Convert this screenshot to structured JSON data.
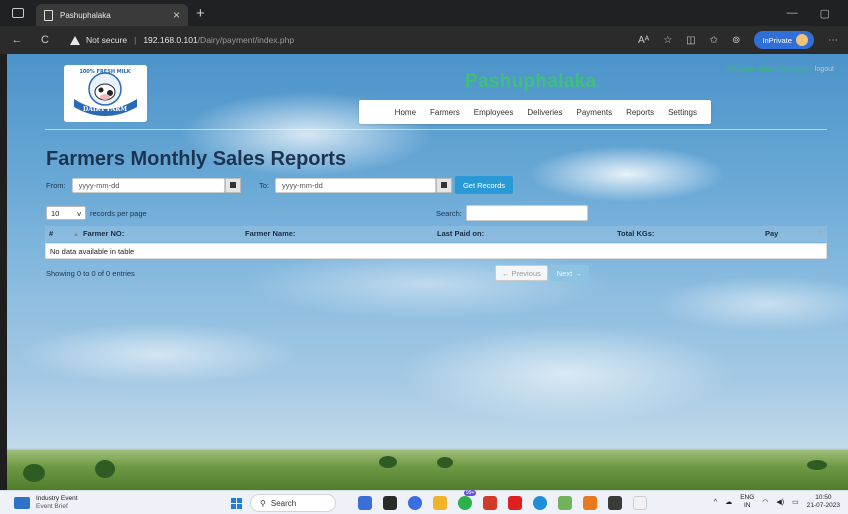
{
  "browser": {
    "tab_title": "Pashuphalaka",
    "close_tab": "×",
    "new_tab": "+",
    "back": "←",
    "reload": "C",
    "security_label": "Not secure",
    "separator": "|",
    "url_host": "192.168.0.101",
    "url_path": "/Dairy/payment/index.php",
    "read_aloud": "Aᴬ",
    "favorite": "☆",
    "split": "◫",
    "favorites_bar": "✩",
    "extensions": "⊚",
    "inprivate_label": "InPrivate",
    "more": "⋯",
    "minimize": "—",
    "restore": "▢"
  },
  "site": {
    "brand": "Pashuphalaka",
    "welcome": "Welcome Admin (Manager)",
    "logout": "logout",
    "logo_text_top": "100% FRESH MILK",
    "logo_text_bottom": "DAIRY FARM",
    "nav": [
      "Home",
      "Farmers",
      "Employees",
      "Deliveries",
      "Payments",
      "Reports",
      "Settings"
    ]
  },
  "report": {
    "heading": "Farmers Monthly Sales Reports",
    "from_label": "From:",
    "from_placeholder": "yyyy-mm-dd",
    "to_label": "To:",
    "to_placeholder": "yyyy-mm-dd",
    "get_button": "Get Records",
    "page_length": "10",
    "page_length_caret": "v",
    "length_label": "records per page",
    "search_label": "Search:",
    "columns": [
      "#",
      "Farmer NO:",
      "Farmer Name:",
      "Last Paid on:",
      "Total KGs:",
      "Pay"
    ],
    "empty_message": "No data available in table",
    "info": "Showing 0 to 0 of 0 entries",
    "prev": "← Previous",
    "next": "Next →"
  },
  "taskbar": {
    "news_title": "Industry Event",
    "news_sub": "Event Brief",
    "search_placeholder": "Search",
    "badge": "99+",
    "tray_arrow": "^",
    "lang_top": "ENG",
    "lang_bottom": "IN",
    "time": "10:50",
    "date": "21-07-2023"
  },
  "colors": {
    "brand": "#3ec07a",
    "heading": "#1d3450",
    "button": "#2a9ad6"
  }
}
